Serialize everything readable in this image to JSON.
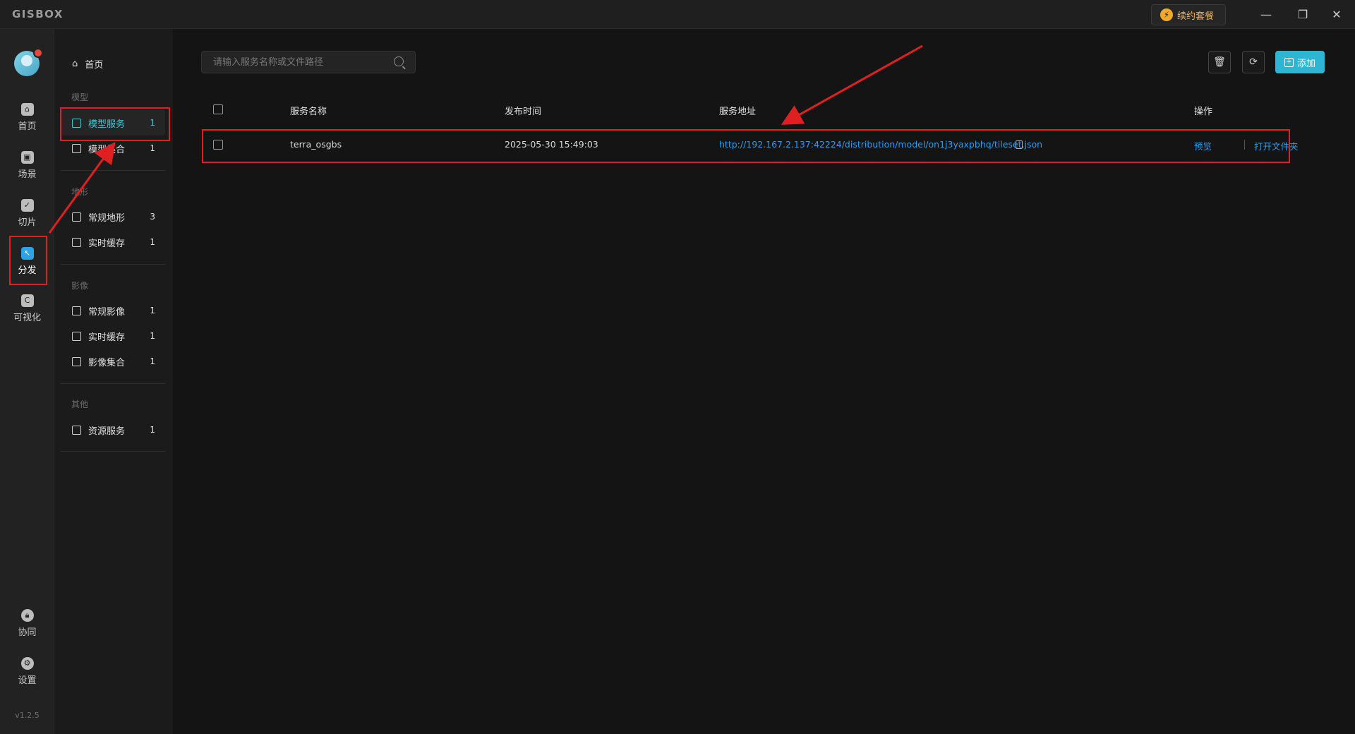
{
  "app": {
    "logo": "GISBOX",
    "renew_label": "续约套餐",
    "version": "v1.2.5"
  },
  "window": {
    "minimize": "—",
    "restore": "❐",
    "close": "✕"
  },
  "rail": [
    {
      "key": "home",
      "label": "首页",
      "icon": "home-icon"
    },
    {
      "key": "scene",
      "label": "场景",
      "icon": "cube-icon"
    },
    {
      "key": "slice",
      "label": "切片",
      "icon": "check-doc-icon"
    },
    {
      "key": "dist",
      "label": "分发",
      "icon": "share-icon",
      "active": true
    },
    {
      "key": "vis",
      "label": "可视化",
      "icon": "chart-icon"
    },
    {
      "key": "collab",
      "label": "协同",
      "icon": "lock-icon"
    },
    {
      "key": "settings",
      "label": "设置",
      "icon": "gear-icon"
    }
  ],
  "sidebar": {
    "home": "首页",
    "groups": {
      "model": "模型",
      "terrain": "地形",
      "imagery": "影像",
      "other": "其他"
    },
    "items": [
      {
        "label": "模型服务",
        "count": "1",
        "active": true
      },
      {
        "label": "模型集合",
        "count": "1"
      },
      {
        "label": "常规地形",
        "count": "3"
      },
      {
        "label": "实时缓存",
        "count": "1"
      },
      {
        "label": "常规影像",
        "count": "1"
      },
      {
        "label": "实时缓存",
        "count": "1"
      },
      {
        "label": "影像集合",
        "count": "1"
      },
      {
        "label": "资源服务",
        "count": "1"
      }
    ]
  },
  "main": {
    "search_placeholder": "请输入服务名称或文件路径",
    "add_label": "添加",
    "columns": {
      "name": "服务名称",
      "time": "发布时间",
      "url": "服务地址",
      "ops": "操作"
    },
    "rows": [
      {
        "name": "terra_osgbs",
        "time": "2025-05-30 15:49:03",
        "url": "http://192.167.2.137:42224/distribution/model/on1j3yaxpbhq/tileset.json",
        "preview": "预览",
        "open_folder": "打开文件夹"
      }
    ]
  },
  "colors": {
    "accent": "#3fc6d6",
    "link": "#2e9bea",
    "annotation": "#e02020",
    "add_button": "#2cb6d4"
  }
}
